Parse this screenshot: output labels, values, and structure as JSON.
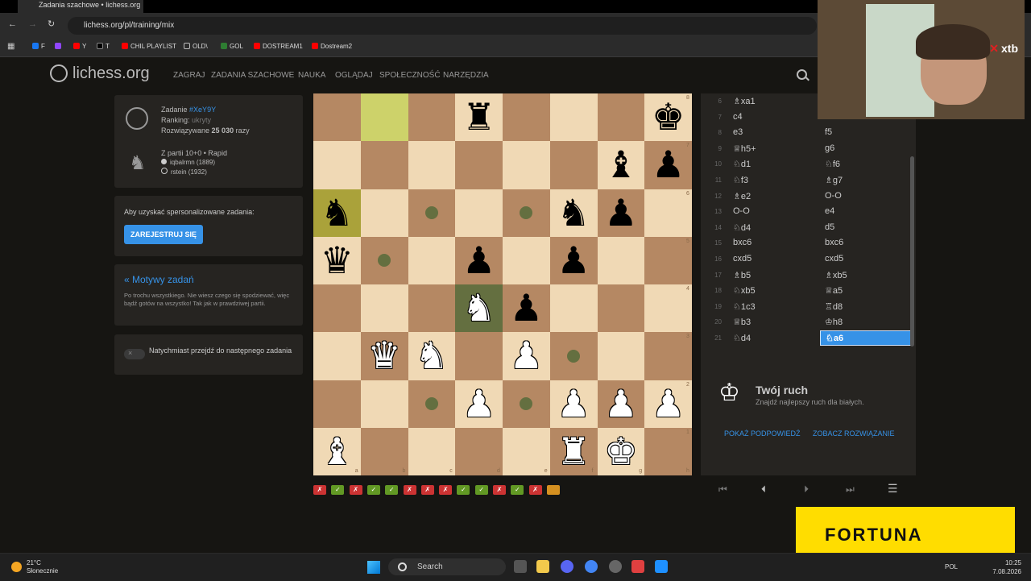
{
  "browser": {
    "tab_title": "Zadania szachowe • lichess.org",
    "url": "lichess.org/pl/training/mix",
    "bookmarks": [
      {
        "label": "F",
        "color": "#1877f2"
      },
      {
        "label": "",
        "color": "#9146ff"
      },
      {
        "label": "Y",
        "color": "#ff0000"
      },
      {
        "label": "T",
        "color": "#000000"
      },
      {
        "label": "CHIL PLAYLIST",
        "color": "#ff0000"
      },
      {
        "label": "OLD\\",
        "color": "#888888"
      },
      {
        "label": "GOL",
        "color": "#2e7d32"
      },
      {
        "label": "DOSTREAM1",
        "color": "#ff0000"
      },
      {
        "label": "Dostream2",
        "color": "#ff0000"
      }
    ]
  },
  "site": {
    "logo": "lichess.org",
    "nav": [
      "ZAGRAJ",
      "ZADANIA SZACHOWE",
      "NAUKA",
      "OGLĄDAJ",
      "SPOŁECZNOŚĆ",
      "NARZĘDZIA"
    ]
  },
  "puzzle": {
    "label": "Zadanie",
    "id": "#XeY9Y",
    "rating_label": "Ranking:",
    "rating_value": "ukryty",
    "played_prefix": "Rozwiązywane",
    "played_count": "25 030",
    "played_suffix": "razy",
    "game_info": "Z partii 10+0 • Rapid",
    "player_white": "iqbalrmn (1889)",
    "player_black": "rstein (1932)"
  },
  "signup": {
    "text": "Aby uzyskać spersonalizowane zadania:",
    "button": "ZAREJESTRUJ SIĘ"
  },
  "theme": {
    "title": "« Motywy zadań",
    "description": "Po trochu wszystkiego. Nie wiesz czego się spodziewać, więc bądź gotów na wszystko! Tak jak w prawdziwej partii."
  },
  "toggle": {
    "label": "Natychmiast przejdź do następnego zadania"
  },
  "moves": [
    {
      "n": "6",
      "w": "♗xa1",
      "b": ""
    },
    {
      "n": "7",
      "w": "c4",
      "b": ""
    },
    {
      "n": "8",
      "w": "e3",
      "b": "f5"
    },
    {
      "n": "9",
      "w": "♕h5+",
      "b": "g6"
    },
    {
      "n": "10",
      "w": "♘d1",
      "b": "♘f6"
    },
    {
      "n": "11",
      "w": "♘f3",
      "b": "♗g7"
    },
    {
      "n": "12",
      "w": "♗e2",
      "b": "O-O"
    },
    {
      "n": "13",
      "w": "O-O",
      "b": "e4"
    },
    {
      "n": "14",
      "w": "♘d4",
      "b": "d5"
    },
    {
      "n": "15",
      "w": "bxc6",
      "b": "bxc6"
    },
    {
      "n": "16",
      "w": "cxd5",
      "b": "cxd5"
    },
    {
      "n": "17",
      "w": "♗b5",
      "b": "♗xb5"
    },
    {
      "n": "18",
      "w": "♘xb5",
      "b": "♕a5"
    },
    {
      "n": "19",
      "w": "♘1c3",
      "b": "♖d8"
    },
    {
      "n": "20",
      "w": "♕b3",
      "b": "♔h8"
    },
    {
      "n": "21",
      "w": "♘d4",
      "b": "♘a6"
    }
  ],
  "turn": {
    "title": "Twój ruch",
    "subtitle": "Znajdź najlepszy ruch dla białych.",
    "hint_button": "POKAŻ PODPOWIEDŹ",
    "solution_button": "ZOBACZ ROZWIĄZANIE"
  },
  "results": [
    "loss",
    "win",
    "loss",
    "win",
    "win",
    "loss",
    "loss",
    "loss",
    "win",
    "win",
    "loss",
    "win",
    "loss",
    "current"
  ],
  "overlay": {
    "xtb": "xtb",
    "fortuna": "FORTUNA"
  },
  "taskbar": {
    "temp": "21°C",
    "weather": "Słonecznie",
    "search_placeholder": "Search",
    "lang": "POL",
    "time": "10:25",
    "date": "7.08.2026"
  }
}
